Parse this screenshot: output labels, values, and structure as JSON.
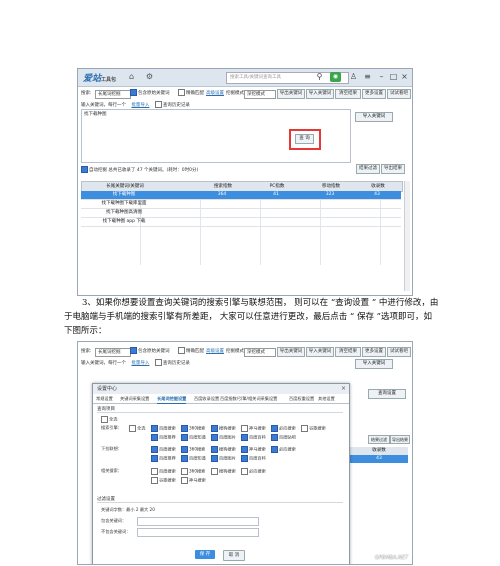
{
  "screenshot1": {
    "app_logo": "爱站",
    "app_logo_sub": "工具包",
    "search_placeholder": "搜索工具/关键词查询工具",
    "toolbar": {
      "label_search": "搜索:",
      "engine": "长尾词挖掘",
      "chk_dedupe": "包含原始关键词",
      "chk_exact": "精确匹配",
      "link_filter": "高级设置",
      "mode_label": "挖掘模式:",
      "mode_value": "深挖模式",
      "btn_export": "导出关键词",
      "btn_import": "导入关键词",
      "btn_clear": "清空结果",
      "btn_more": "更多设置",
      "btn_wizard": "试试看吧"
    },
    "input_label": "输入关键词，每行一个",
    "link_batch": "批量导入",
    "link_history": "查询历史记录",
    "textarea_value": "找下载种图",
    "btn_import_kw": "导入关键词",
    "btn_start": "查 询",
    "btn_settings": "查询设置",
    "status_text": "自动挖掘  总共已收录了 47 个关键词。(耗时：0时0分)",
    "btn_filter": "结果过滤",
    "btn_export_res": "导出结果",
    "table_headers": [
      "长尾关键词/关键词",
      "搜索指数",
      "PC指数",
      "移动指数",
      "收录数",
      "排名"
    ],
    "table_rows": [
      [
        "找下载种图",
        "364",
        "41",
        "323",
        "43"
      ],
      [
        "找下载种图下载库里面",
        "",
        "",
        "",
        ""
      ],
      [
        "找下载种图高清图",
        "",
        "",
        "",
        ""
      ],
      [
        "找下载种图 app 下载",
        "",
        "",
        "",
        ""
      ]
    ]
  },
  "caption": {
    "line": "3、如果你想要设置查询关键词的搜索引擎与联想范围，  则可以在 “查询设置  ” 中进行修改，由于电脑端与手机端的搜索引擎有所差距，  大家可以任意进行更改，最后点击 “ 保存 ”选项即可，如下图所示："
  },
  "screenshot2": {
    "dialog_title": "设置中心",
    "tabs": [
      "常规设置",
      "关键词采集设置",
      "长尾词挖掘设置",
      "百度收录设置",
      "百度指数/引擎/相关词采集设置",
      "百度权重设置",
      "其他设置"
    ],
    "section_query": "查询项目",
    "engine_label": "搜索引擎：",
    "engines": [
      "全选",
      "百度搜索",
      "360搜索",
      "搜狗搜索",
      "神马搜索",
      "必应搜索",
      "谷歌搜索"
    ],
    "sub_labels": [
      "百度推荐",
      "百度知道",
      "百度图片",
      "百度百科",
      "百度贴吧"
    ],
    "dropdown_label": "下拉联想：",
    "related_label": "相关搜索：",
    "section_filter": "过滤设置",
    "filter_line1": "关键词字数：最小 2   最大 20",
    "filter_line2": "包含关键词：",
    "filter_line3": "不包含关键词：",
    "btn_save": "保 存",
    "btn_cancel": "取 消",
    "watermark": "GPBMBA.NET"
  }
}
